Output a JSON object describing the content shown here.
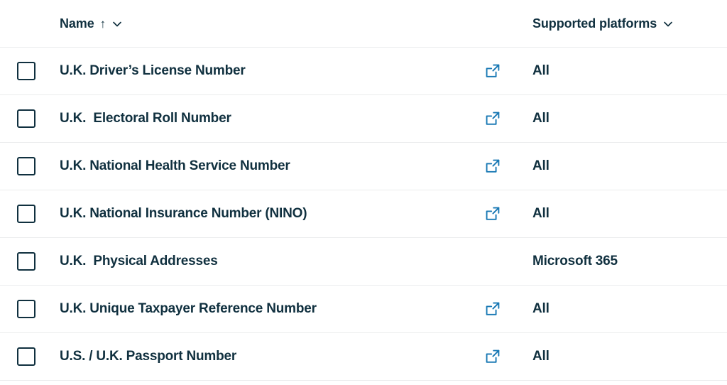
{
  "colors": {
    "text": "#10303f",
    "link_icon": "#1878b4",
    "row_divider": "#ebeced",
    "background": "#ffffff",
    "checkbox_border": "#10303f"
  },
  "header": {
    "name_column": {
      "label": "Name",
      "sort_indicator": "↑",
      "filter_icon": "chevron-down-icon"
    },
    "platform_column": {
      "label": "Supported platforms",
      "filter_icon": "chevron-down-icon"
    }
  },
  "rows": [
    {
      "checked": false,
      "name": "U.K. Driver’s License Number",
      "has_external_link": true,
      "external_link_icon": "external-link-icon",
      "platforms": "All"
    },
    {
      "checked": false,
      "name": "U.K.  Electoral Roll Number",
      "has_external_link": true,
      "external_link_icon": "external-link-icon",
      "platforms": "All"
    },
    {
      "checked": false,
      "name": "U.K. National Health Service Number",
      "has_external_link": true,
      "external_link_icon": "external-link-icon",
      "platforms": "All"
    },
    {
      "checked": false,
      "name": "U.K. National Insurance Number (NINO)",
      "has_external_link": true,
      "external_link_icon": "external-link-icon",
      "platforms": "All"
    },
    {
      "checked": false,
      "name": "U.K.  Physical Addresses",
      "has_external_link": false,
      "external_link_icon": "",
      "platforms": "Microsoft 365"
    },
    {
      "checked": false,
      "name": "U.K. Unique Taxpayer Reference Number",
      "has_external_link": true,
      "external_link_icon": "external-link-icon",
      "platforms": "All"
    },
    {
      "checked": false,
      "name": "U.S. / U.K. Passport Number",
      "has_external_link": true,
      "external_link_icon": "external-link-icon",
      "platforms": "All"
    }
  ]
}
